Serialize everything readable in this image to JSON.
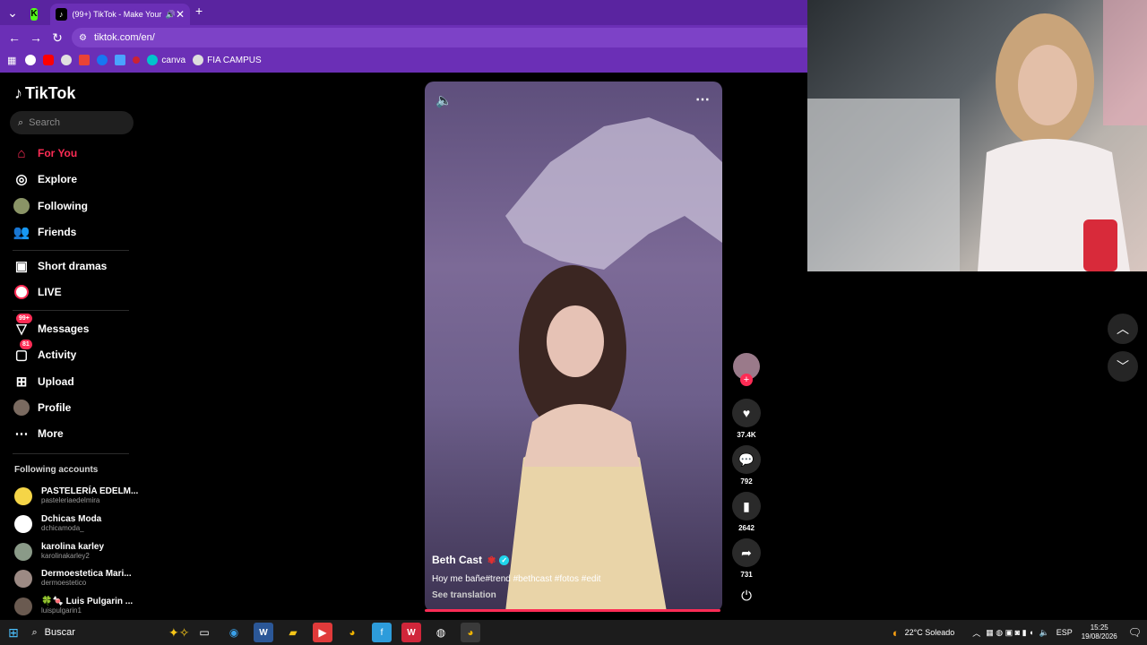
{
  "browser": {
    "tabs": [
      {
        "label": "K",
        "color": "#53fc18"
      },
      {
        "label": "(99+) TikTok - Make Your Da",
        "active": true
      }
    ],
    "new_tab": "+",
    "url": "tiktok.com/en/",
    "bookmarks": [
      {
        "label": "",
        "icon": "google-icon"
      },
      {
        "label": "",
        "icon": "youtube-icon"
      },
      {
        "label": "",
        "icon": "chrome-icon"
      },
      {
        "label": "",
        "icon": "gmail-icon"
      },
      {
        "label": "",
        "icon": "facebook-icon"
      },
      {
        "label": "",
        "icon": "app-icon"
      },
      {
        "label": "",
        "icon": "pin-icon"
      },
      {
        "label": "canva",
        "icon": "canva-icon"
      },
      {
        "label": "FIA CAMPUS",
        "icon": "globe-icon"
      }
    ]
  },
  "sidebar": {
    "logo": "TikTok",
    "search_placeholder": "Search",
    "nav": [
      {
        "label": "For You",
        "icon": "home-icon",
        "active": true
      },
      {
        "label": "Explore",
        "icon": "compass-icon"
      },
      {
        "label": "Following",
        "icon": "following-avatar-icon"
      },
      {
        "label": "Friends",
        "icon": "friends-icon"
      },
      {
        "label": "Short dramas",
        "icon": "film-icon"
      },
      {
        "label": "LIVE",
        "icon": "live-icon"
      },
      {
        "label": "Messages",
        "icon": "messages-icon",
        "badge": "99+"
      },
      {
        "label": "Activity",
        "icon": "activity-icon",
        "badge": "81"
      },
      {
        "label": "Upload",
        "icon": "upload-icon"
      },
      {
        "label": "Profile",
        "icon": "profile-avatar-icon"
      },
      {
        "label": "More",
        "icon": "more-icon"
      }
    ],
    "following_title": "Following accounts",
    "accounts": [
      {
        "name": "PASTELERÍA EDELM...",
        "handle": "pasteleriaedelmira",
        "color": "#f5d547"
      },
      {
        "name": "Dchicas Moda",
        "handle": "dchicamoda_",
        "color": "#ffffff"
      },
      {
        "name": "karolina karley",
        "handle": "karolinakarley2",
        "color": "#8a9a88"
      },
      {
        "name": "Dermoestetica Mari...",
        "handle": "dermoestetico",
        "color": "#9c8a84"
      },
      {
        "name": "🍀🍬 Luis Pulgarin ...",
        "handle": "luispulgarin1",
        "color": "#6a5a50"
      }
    ]
  },
  "video": {
    "author": "Beth Cast",
    "caption": "Hoy me bañe#trend #bethcast #fotos #edit",
    "see_translation": "See translation",
    "likes": "37.4K",
    "comments": "792",
    "saves": "2642",
    "shares": "731"
  },
  "taskbar": {
    "search": "Buscar",
    "weather": "22°C  Soleado",
    "lang": "ESP",
    "time": "15:25",
    "date": "19/08/2026"
  }
}
